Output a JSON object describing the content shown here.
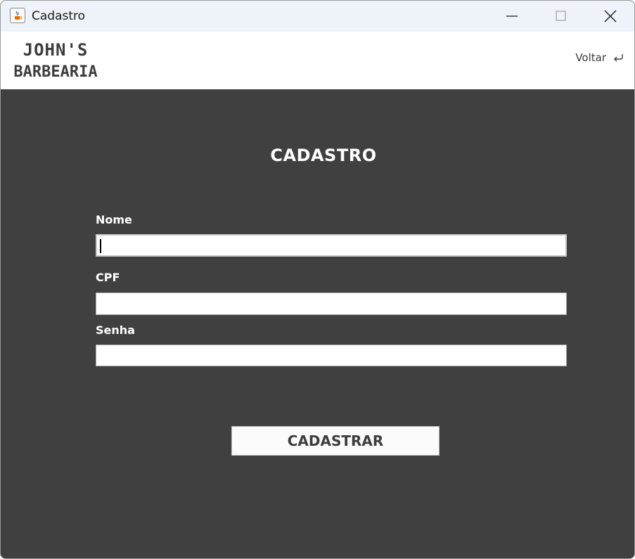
{
  "window": {
    "title": "Cadastro",
    "icon": "java-cup-icon",
    "controls": [
      "minimize-icon",
      "maximize-icon",
      "close-icon"
    ]
  },
  "header": {
    "logo_line1": "JOHN'S",
    "logo_line2": "BARBEARIA",
    "back_label": "Voltar",
    "back_icon": "return-arrow-icon"
  },
  "form": {
    "title": "CADASTRO",
    "fields": [
      {
        "label": "Nome",
        "value": ""
      },
      {
        "label": "CPF",
        "value": ""
      },
      {
        "label": "Senha",
        "value": ""
      }
    ],
    "submit_label": "CADASTRAR"
  },
  "colors": {
    "background": "#404040",
    "header_background": "#ffffff",
    "titlebar_background": "#eef2f9",
    "text_light": "#ffffff",
    "text_dark": "#3d3d3d"
  }
}
